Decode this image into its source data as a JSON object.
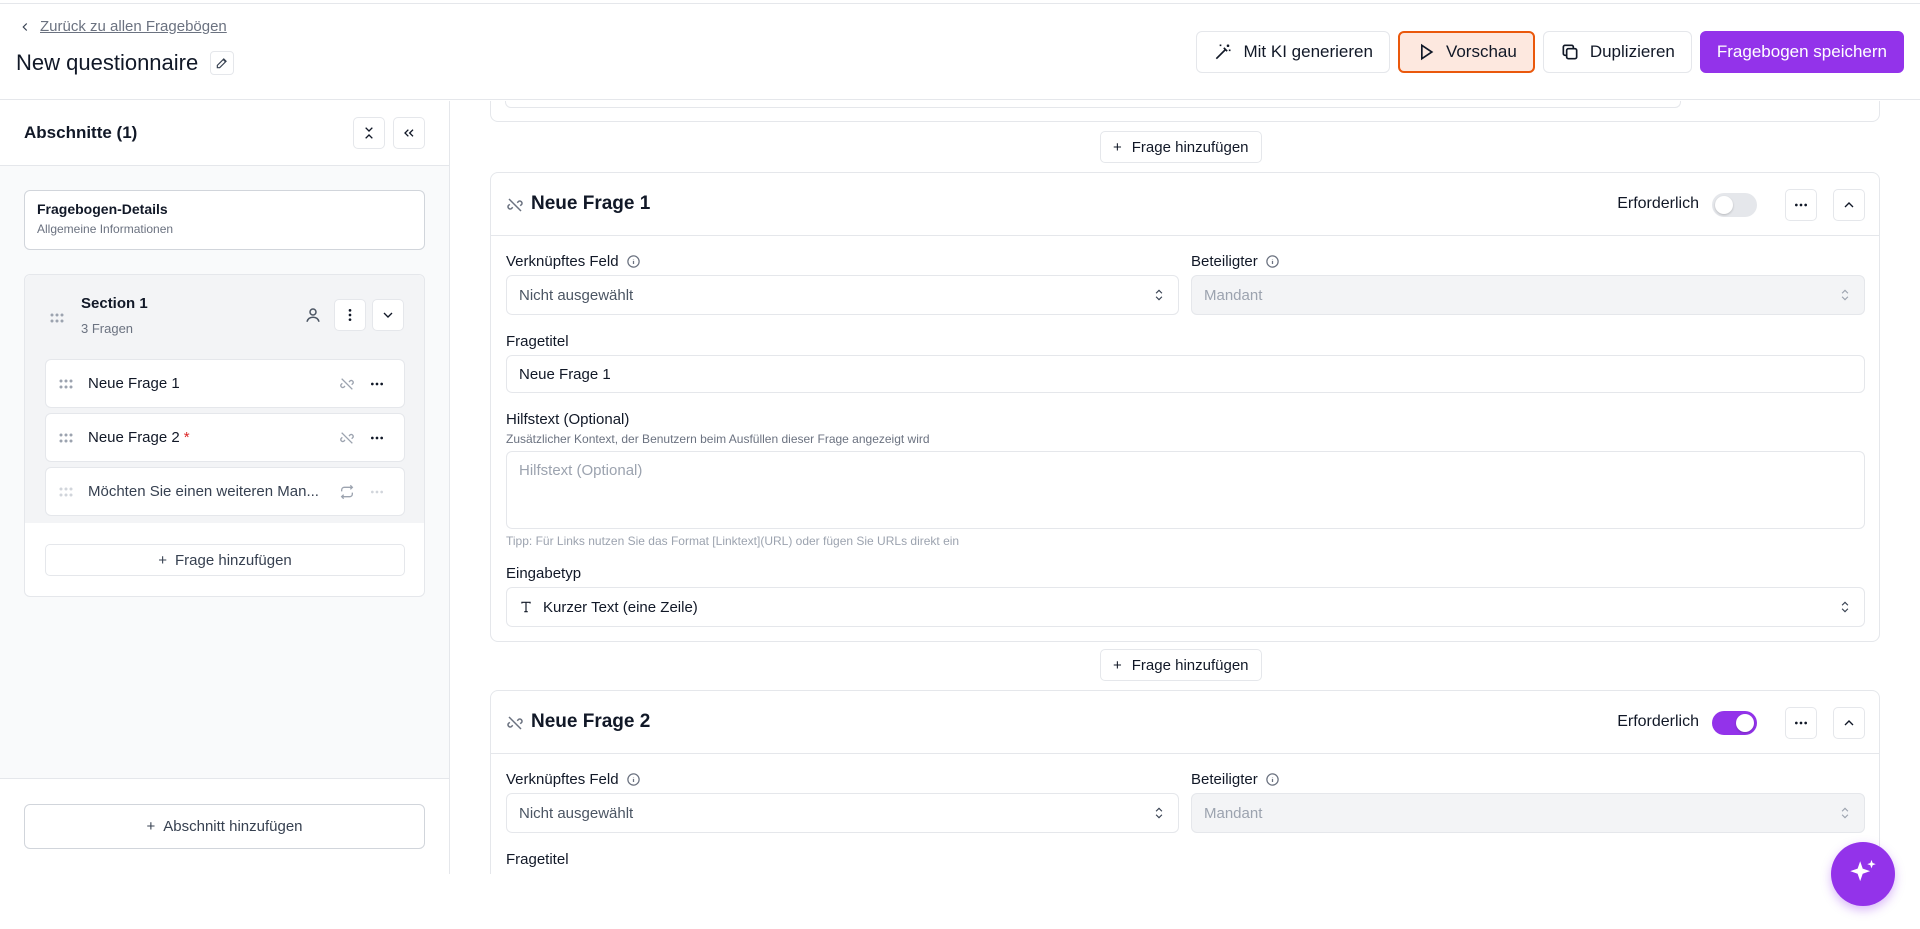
{
  "header": {
    "back_label": "Zurück zu allen Fragebögen",
    "title": "New questionnaire",
    "actions": {
      "ai_generate": "Mit KI generieren",
      "preview": "Vorschau",
      "duplicate": "Duplizieren",
      "save": "Fragebogen speichern"
    }
  },
  "sidebar": {
    "title": "Abschnitte (1)",
    "details": {
      "title": "Fragebogen-Details",
      "subtitle": "Allgemeine Informationen"
    },
    "section": {
      "name": "Section 1",
      "count": "3 Fragen",
      "questions": [
        {
          "label": "Neue Frage 1",
          "required_mark": ""
        },
        {
          "label": "Neue Frage 2",
          "required_mark": "*"
        },
        {
          "label": "Möchten Sie einen weiteren Man..."
        }
      ],
      "add_question": "Frage hinzufügen"
    },
    "add_section": "Abschnitt hinzufügen"
  },
  "main": {
    "add_question": "Frage hinzufügen",
    "q1": {
      "title": "Neue Frage 1",
      "required_label": "Erforderlich",
      "required": false,
      "linked_field_label": "Verknüpftes Feld",
      "linked_field_value": "Nicht ausgewählt",
      "participant_label": "Beteiligter",
      "participant_value": "Mandant",
      "question_title_label": "Fragetitel",
      "question_title_value": "Neue Frage 1",
      "help_label": "Hilfstext (Optional)",
      "help_sub": "Zusätzlicher Kontext, der Benutzern beim Ausfüllen dieser Frage angezeigt wird",
      "help_placeholder": "Hilfstext (Optional)",
      "tip": "Tipp: Für Links nutzen Sie das Format [Linktext](URL) oder fügen Sie URLs direkt ein",
      "input_type_label": "Eingabetyp",
      "input_type_value": "Kurzer Text (eine Zeile)"
    },
    "q2": {
      "title": "Neue Frage 2",
      "required_label": "Erforderlich",
      "required": true,
      "linked_field_label": "Verknüpftes Feld",
      "linked_field_value": "Nicht ausgewählt",
      "participant_label": "Beteiligter",
      "participant_value": "Mandant",
      "question_title_label": "Fragetitel"
    }
  },
  "colors": {
    "accent": "#9333ea",
    "preview_border": "#ea580c",
    "preview_bg": "#fde8df"
  }
}
